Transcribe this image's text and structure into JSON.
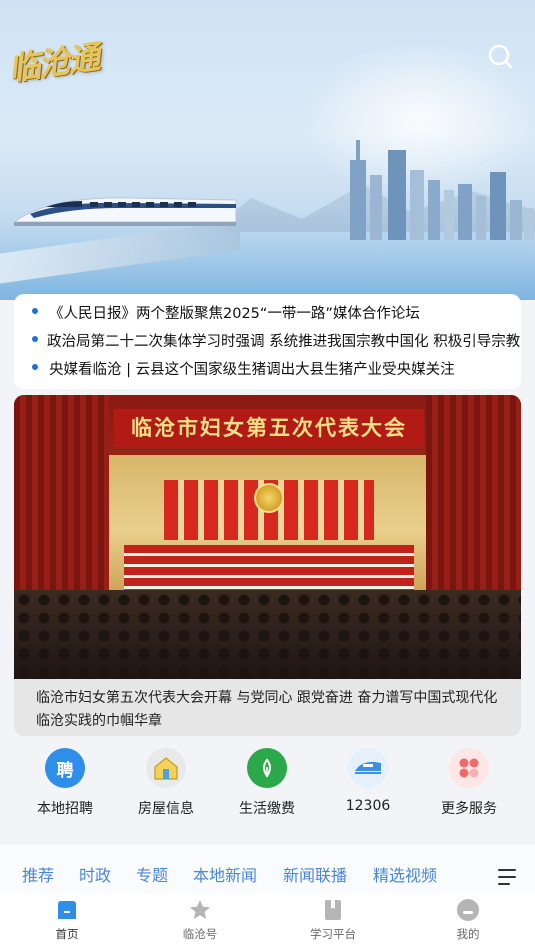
{
  "header": {
    "logo_text": "临沧通",
    "search_icon": "search-icon"
  },
  "ticker": [
    {
      "text": "《人民日报》两个整版聚焦2025“一带一路”媒体合作论坛"
    },
    {
      "text": "政治局第二十二次集体学习时强调 系统推进我国宗教中国化 积极引导宗教"
    },
    {
      "text": "央媒看临沧 | 云县这个国家级生猪调出大县生猪产业受央媒关注"
    }
  ],
  "headline": {
    "banner_text": "临沧市妇女第五次代表大会",
    "caption": "临沧市妇女第五次代表大会开幕 与党同心 跟党奋进 奋力谱写中国式现代化临沧实践的巾帼华章"
  },
  "services": [
    {
      "label": "本地招聘",
      "icon": "recruit-icon",
      "glyph": "聘",
      "color": "#2f8fe8"
    },
    {
      "label": "房屋信息",
      "icon": "house-icon",
      "color": "#9a9a9a"
    },
    {
      "label": "生活缴费",
      "icon": "payment-icon",
      "color": "#2aa84a"
    },
    {
      "label": "12306",
      "icon": "train-icon",
      "color": "#3d8fe0"
    },
    {
      "label": "更多服务",
      "icon": "more-services-icon",
      "color": "#f06a6a"
    }
  ],
  "channels": [
    "推荐",
    "时政",
    "专题",
    "本地新闻",
    "新闻联播",
    "精选视频"
  ],
  "bottom_nav": [
    {
      "label": "首页",
      "icon": "home-icon",
      "active": true
    },
    {
      "label": "临沧号",
      "icon": "star-icon",
      "active": false
    },
    {
      "label": "学习平台",
      "icon": "book-icon",
      "active": false
    },
    {
      "label": "我的",
      "icon": "profile-icon",
      "active": false
    }
  ],
  "colors": {
    "accent": "#4a86d8",
    "bullet": "#1d6fe0",
    "logo_gold": "#e9c45a"
  }
}
